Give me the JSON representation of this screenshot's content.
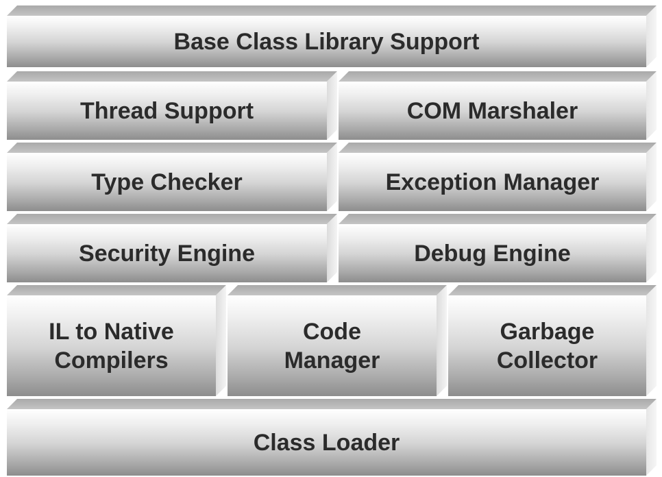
{
  "diagram": {
    "blocks": {
      "base_class_library": "Base Class Library Support",
      "thread_support": "Thread Support",
      "com_marshaler": "COM Marshaler",
      "type_checker": "Type Checker",
      "exception_manager": "Exception Manager",
      "security_engine": "Security Engine",
      "debug_engine": "Debug Engine",
      "il_to_native": "IL to Native\nCompilers",
      "code_manager": "Code\nManager",
      "garbage_collector": "Garbage\nCollector",
      "class_loader": "Class Loader"
    },
    "colors": {
      "text": "#2b2b2b",
      "face_top": "#ffffff",
      "face_bottom": "#8d8d8d",
      "bevel": "#b5b5b5"
    }
  }
}
